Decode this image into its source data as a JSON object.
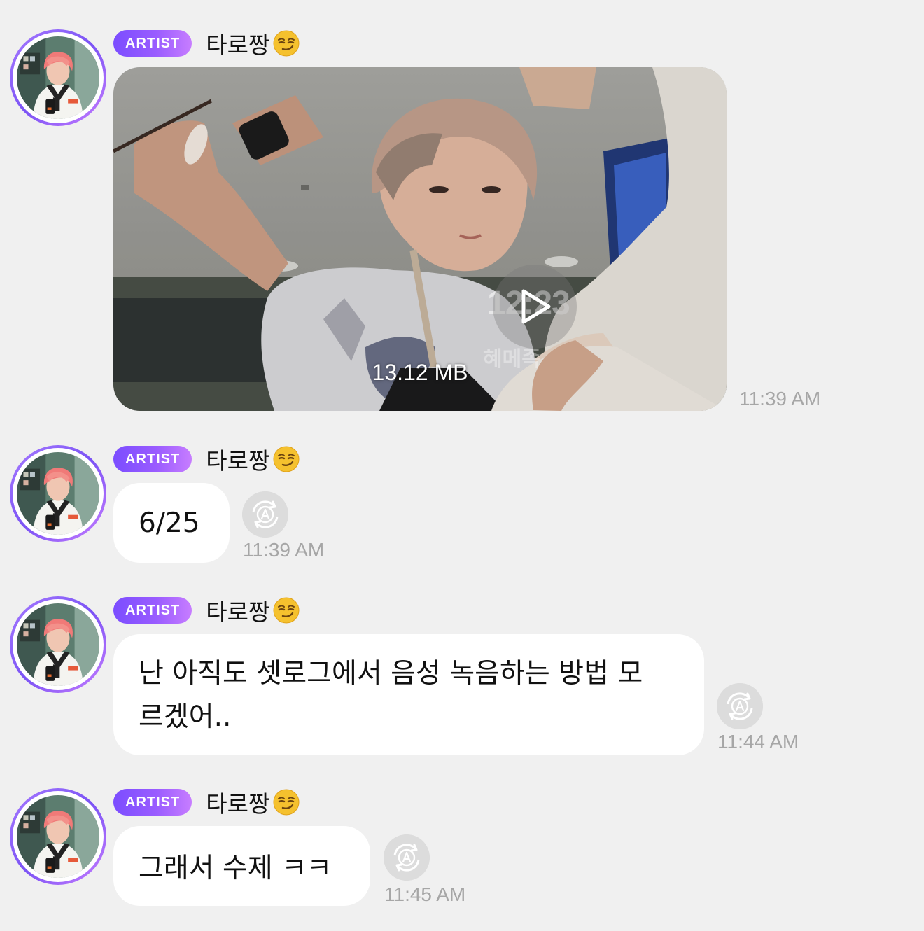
{
  "artist_badge": "ARTIST",
  "sender_name": "타로짱",
  "icons": {
    "emoji": "smirking-face-icon",
    "translate": "auto-translate-icon",
    "play": "play-icon"
  },
  "colors": {
    "background": "#f0f0f0",
    "badge_start": "#7b4dff",
    "badge_end": "#c77dff",
    "bubble": "#ffffff",
    "timestamp": "#a6a6a6"
  },
  "messages": [
    {
      "type": "video",
      "file_size": "13.12 MB",
      "overlay_time": "12:23",
      "overlay_text": "혜메족",
      "time": "11:39 AM"
    },
    {
      "type": "text",
      "text": "6/25",
      "time": "11:39 AM"
    },
    {
      "type": "text",
      "text_line1": "난 아직도 셋로그에서 음성 녹음하는 방법 모",
      "text_line2": "르겠어..",
      "time": "11:44 AM"
    },
    {
      "type": "text",
      "text": "그래서 수제 ㅋㅋ",
      "time": "11:45 AM"
    }
  ]
}
